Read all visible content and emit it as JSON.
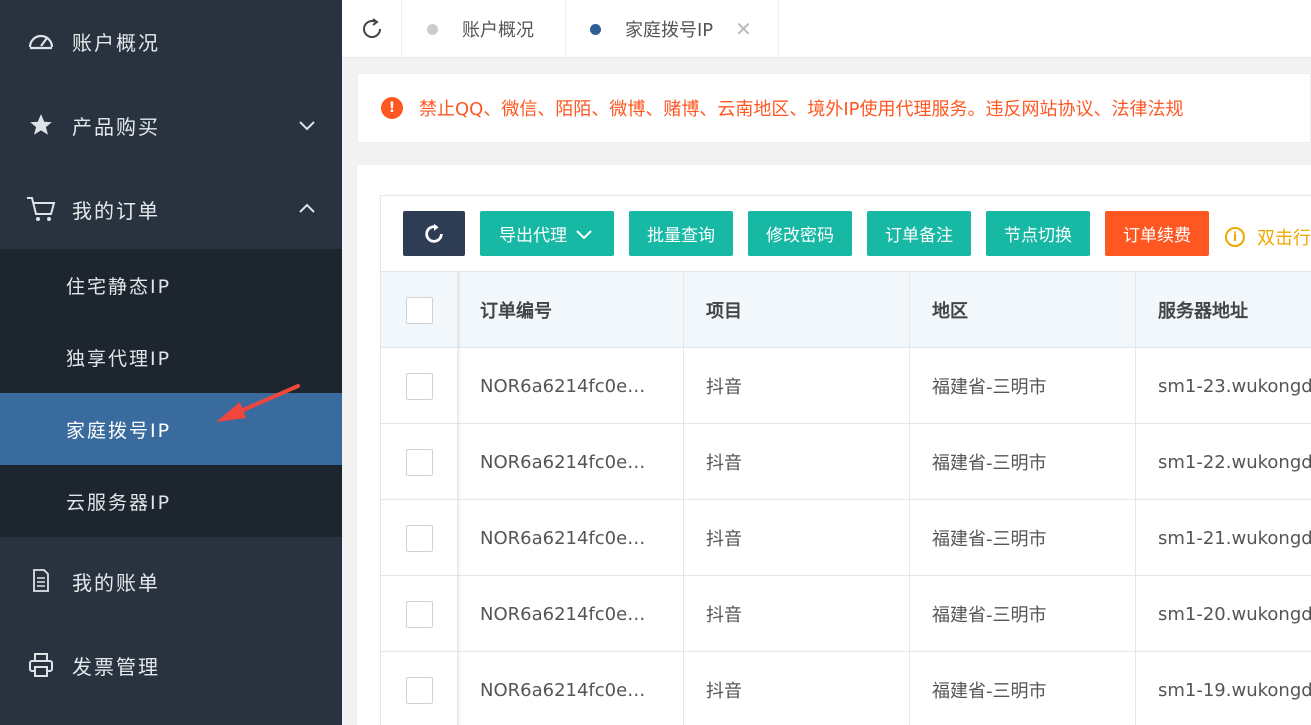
{
  "sidebar": {
    "items": [
      {
        "label": "账户概况",
        "icon": "dashboard-icon"
      },
      {
        "label": "产品购买",
        "icon": "star-icon"
      },
      {
        "label": "我的订单",
        "icon": "cart-icon"
      },
      {
        "label": "我的账单",
        "icon": "document-icon"
      },
      {
        "label": "发票管理",
        "icon": "printer-icon"
      }
    ],
    "submenu": [
      {
        "label": "住宅静态IP"
      },
      {
        "label": "独享代理IP"
      },
      {
        "label": "家庭拨号IP"
      },
      {
        "label": "云服务器IP"
      }
    ]
  },
  "tabs": [
    {
      "label": "账户概况"
    },
    {
      "label": "家庭拨号IP"
    }
  ],
  "notice": "禁止QQ、微信、陌陌、微博、赌博、云南地区、境外IP使用代理服务。违反网站协议、法律法规",
  "toolbar": {
    "export": "导出代理",
    "batch_query": "批量查询",
    "change_password": "修改密码",
    "order_note": "订单备注",
    "node_switch": "节点切换",
    "renew": "订单续费",
    "tip": "双击行"
  },
  "table": {
    "headers": [
      "订单编号",
      "项目",
      "地区",
      "服务器地址"
    ],
    "rows": [
      [
        "NOR6a6214fc0e…",
        "抖音",
        "福建省-三明市",
        "sm1-23.wukongd"
      ],
      [
        "NOR6a6214fc0e…",
        "抖音",
        "福建省-三明市",
        "sm1-22.wukongd"
      ],
      [
        "NOR6a6214fc0e…",
        "抖音",
        "福建省-三明市",
        "sm1-21.wukongd"
      ],
      [
        "NOR6a6214fc0e…",
        "抖音",
        "福建省-三明市",
        "sm1-20.wukongd"
      ],
      [
        "NOR6a6214fc0e…",
        "抖音",
        "福建省-三明市",
        "sm1-19.wukongd"
      ]
    ]
  },
  "colors": {
    "sidebar_bg": "#28333f",
    "submenu_bg": "#1d252e",
    "active_bg": "#3a6b9f",
    "teal": "#17b8a4",
    "orange": "#ff5722",
    "dark_button": "#2f3d54",
    "annotation_arrow": "#f0463c"
  }
}
